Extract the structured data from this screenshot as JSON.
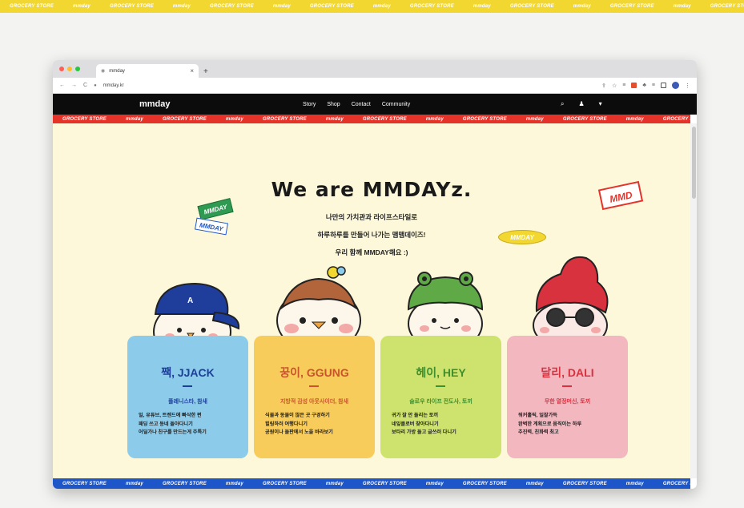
{
  "marquee": {
    "top_items": [
      "GROCERY STORE",
      "mmday",
      "GROCERY STORE",
      "mmday",
      "GROCERY STORE",
      "mmday",
      "GROCERY STORE",
      "mmday",
      "GROCERY STORE",
      "mmday",
      "GROCERY STORE",
      "mmday",
      "GROCERY STORE",
      "mmday",
      "GROCERY STORE",
      "mmday"
    ],
    "red_items": [
      "GROCERY STORE",
      "mmday",
      "GROCERY STORE",
      "mmday",
      "GROCERY STORE",
      "mmday",
      "GROCERY STORE",
      "mmday",
      "GROCERY STORE",
      "mmday",
      "GROCERY STORE",
      "mmday",
      "GROCERY STORE",
      "mmday"
    ],
    "blue_items": [
      "GROCERY STORE",
      "mmday",
      "GROCERY STORE",
      "mmday",
      "GROCERY STORE",
      "mmday",
      "GROCERY STORE",
      "mmday",
      "GROCERY STORE",
      "mmday",
      "GROCERY STORE",
      "mmday",
      "GROCERY STORE",
      "mmday"
    ]
  },
  "browser": {
    "tab_title": "mmday",
    "tab_close": "×",
    "new_tab": "+",
    "url": "mmday.kr",
    "icons": [
      "back-icon",
      "forward-icon",
      "reload-icon",
      "lock-icon",
      "share-icon",
      "bookmark-icon",
      "extension-icons",
      "profile-icon",
      "menu-icon"
    ]
  },
  "site_nav": {
    "brand": "mmday",
    "menu": [
      "Story",
      "Shop",
      "Contact",
      "Community"
    ],
    "icons": [
      "search-icon",
      "user-icon",
      "cart-icon"
    ]
  },
  "hero": {
    "title": "We are MMDAYz.",
    "lines": [
      "나만의 가치관과 라이프스타일로",
      "하루하루를 만들어 나가는 맴맴데이즈!",
      "우리 함께 MMDAY해요 :)"
    ]
  },
  "stickers": {
    "left_top": "MMDAY",
    "left_bottom": "MMDAY",
    "right": "MMD",
    "middle": "MMDAY"
  },
  "cards": [
    {
      "name": "짹, JJACK",
      "role": "플레니스타, 참새",
      "traits": [
        "일, 유튜브, 트렌드에 빠삭한 편",
        "패딩 쓰고 동네 돌아다니기",
        "어딜가나 친구를 만드는게 주특기"
      ],
      "bg": "#8ccbea",
      "accent": "#1d3f9a"
    },
    {
      "name": "꿍이, GGUNG",
      "role": "지방적 감성 아웃사이더, 참새",
      "traits": [
        "식물과 동물이 많은 곳 구경하기",
        "힐링하러 여행다니기",
        "공원이나 들판에서 노을 바라보기"
      ],
      "bg": "#f8cc5a",
      "accent": "#c9542c"
    },
    {
      "name": "헤이, HEY",
      "role": "슬로우 라이프 전도사, 토끼",
      "traits": [
        "귀가 잘 안 들리는 토끼",
        "네잎클로버 찾아다니기",
        "보타리 가방 들고 글쓰러 다니기"
      ],
      "bg": "#cde36d",
      "accent": "#3e8f2e"
    },
    {
      "name": "달리, DALI",
      "role": "무한 열정머신, 토끼",
      "traits": [
        "워커홀릭, 일잘가득",
        "완벽한 계획으로 움직이는 하루",
        "추진력, 친화력 최고"
      ],
      "bg": "#f3b7c0",
      "accent": "#d8323f"
    }
  ],
  "colors": {
    "yellow_band": "#f2d730",
    "red_band": "#e6332a",
    "blue_band": "#1d56c8",
    "page_bg": "#fdf8d9",
    "nav_bg": "#0c0c0c"
  }
}
